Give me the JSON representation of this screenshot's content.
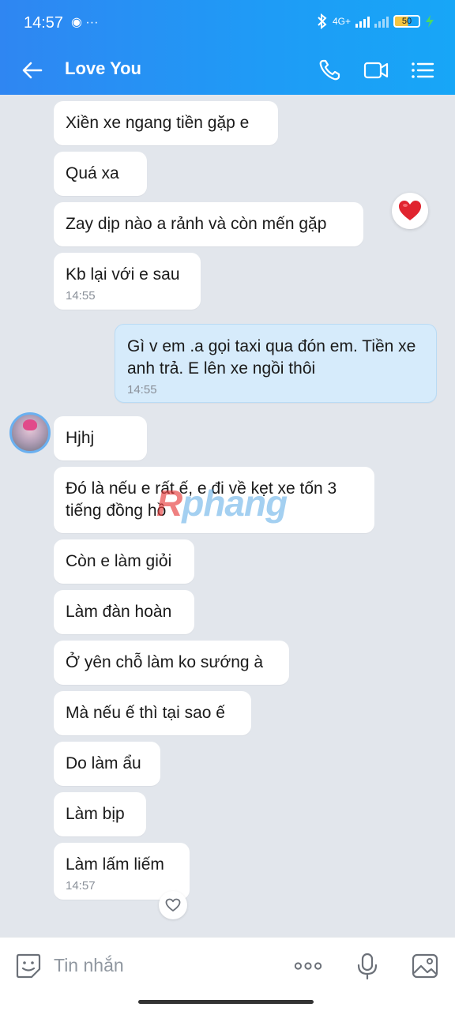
{
  "status_bar": {
    "time": "14:57",
    "extra_icons": "◉ ···",
    "network": "4G+",
    "battery": "50"
  },
  "header": {
    "title": "Love You"
  },
  "messages": [
    {
      "text": "Xiền xe ngang tiền gặp e",
      "time": ""
    },
    {
      "text": "Quá xa",
      "time": ""
    },
    {
      "text": "Zay dịp nào a rảnh và còn mến gặp",
      "time": ""
    },
    {
      "text": "Kb lại với e sau",
      "time": "14:55"
    },
    {
      "text": "Gì v em .a gọi taxi qua đón em. Tiền xe anh trả. E lên xe ngồi thôi",
      "time": "14:55"
    },
    {
      "text": "Hjhj",
      "time": ""
    },
    {
      "text": "Đó là nếu e rất ế, e đi về kẹt xe tốn 3 tiếng đồng hồ",
      "time": ""
    },
    {
      "text": "Còn e làm giỏi",
      "time": ""
    },
    {
      "text": "Làm đàn hoàn",
      "time": ""
    },
    {
      "text": "Ở yên chỗ làm ko sướng à",
      "time": ""
    },
    {
      "text": "Mà nếu ế thì tại sao ế",
      "time": ""
    },
    {
      "text": "Do làm ẩu",
      "time": ""
    },
    {
      "text": "Làm bịp",
      "time": ""
    },
    {
      "text": "Làm lấm liếm",
      "time": "14:57"
    }
  ],
  "watermark": {
    "r": "R",
    "rest": "phang"
  },
  "input": {
    "placeholder": "Tin nhắn"
  },
  "colors": {
    "header": "#1e9cf6",
    "outgoing_bubble": "#d6ebfb",
    "incoming_bubble": "#ffffff",
    "background": "#e2e6ec"
  }
}
